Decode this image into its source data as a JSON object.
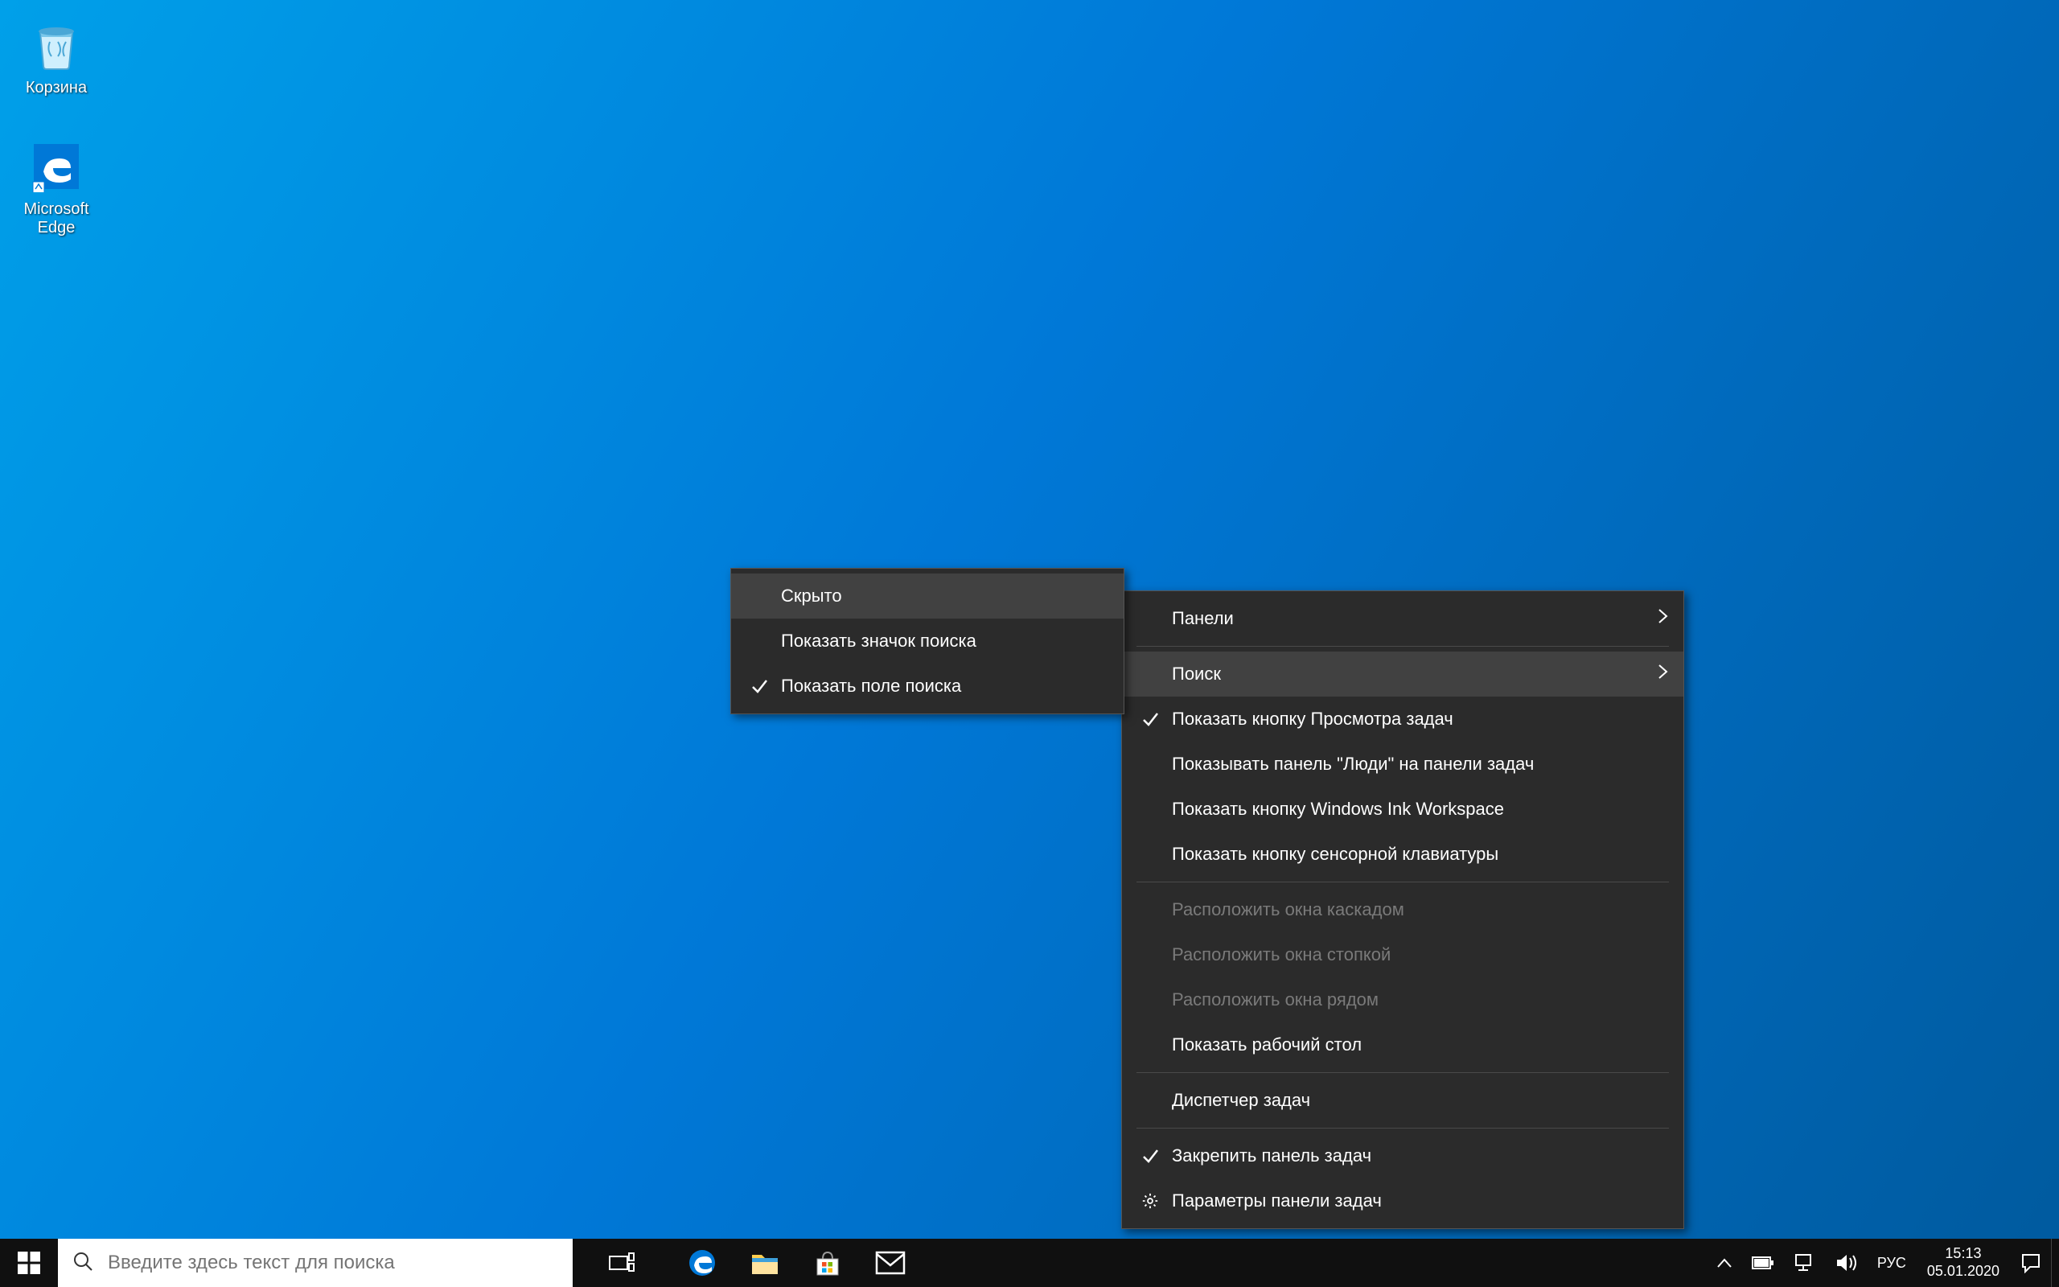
{
  "desktop_icons": {
    "recycle_bin": "Корзина",
    "edge": "Microsoft Edge"
  },
  "taskbar": {
    "search_placeholder": "Введите здесь текст для поиска"
  },
  "systray": {
    "language": "РУС",
    "time": "15:13",
    "date": "05.01.2020"
  },
  "context_menu": {
    "panels": "Панели",
    "search": "Поиск",
    "show_task_view": "Показать кнопку Просмотра задач",
    "show_people": "Показывать панель \"Люди\" на панели задач",
    "show_ink": "Показать кнопку Windows Ink Workspace",
    "show_touch_kb": "Показать кнопку сенсорной клавиатуры",
    "cascade": "Расположить окна каскадом",
    "stack": "Расположить окна стопкой",
    "side_by_side": "Расположить окна рядом",
    "show_desktop": "Показать рабочий стол",
    "task_manager": "Диспетчер задач",
    "lock_taskbar": "Закрепить панель задач",
    "taskbar_settings": "Параметры панели задач"
  },
  "search_submenu": {
    "hidden": "Скрыто",
    "show_icon": "Показать значок поиска",
    "show_box": "Показать поле поиска"
  }
}
